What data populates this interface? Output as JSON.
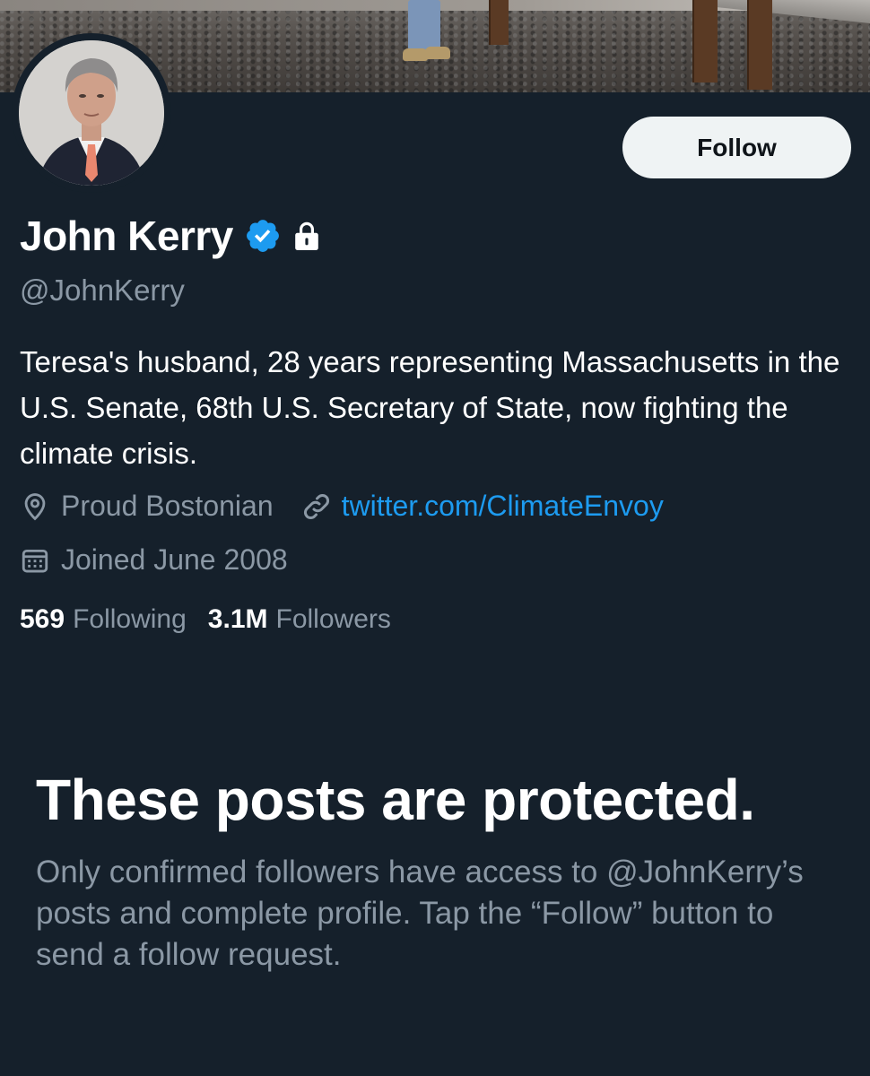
{
  "profile": {
    "name": "John Kerry",
    "handle": "@JohnKerry",
    "bio": "Teresa's husband, 28 years representing Massachusetts in the U.S. Senate, 68th U.S. Secretary of State, now fighting the climate crisis.",
    "location": "Proud Bostonian",
    "website": "twitter.com/ClimateEnvoy",
    "joined": "Joined June 2008",
    "verified": true,
    "protected": true
  },
  "actions": {
    "follow_label": "Follow"
  },
  "stats": {
    "following_count": "569",
    "following_label": "Following",
    "followers_count": "3.1M",
    "followers_label": "Followers"
  },
  "protected_notice": {
    "title": "These posts are protected.",
    "body": "Only confirmed followers have access to @JohnKerry’s posts and complete profile. Tap the “Follow” button to send a follow request."
  },
  "icons": {
    "verified": "verified-badge-icon",
    "protected": "lock-icon",
    "location": "location-pin-icon",
    "website": "link-icon",
    "joined": "calendar-icon"
  },
  "colors": {
    "background": "#15202b",
    "secondary_text": "#8b98a5",
    "accent": "#1d9bf0",
    "button_bg": "#eff3f4"
  }
}
